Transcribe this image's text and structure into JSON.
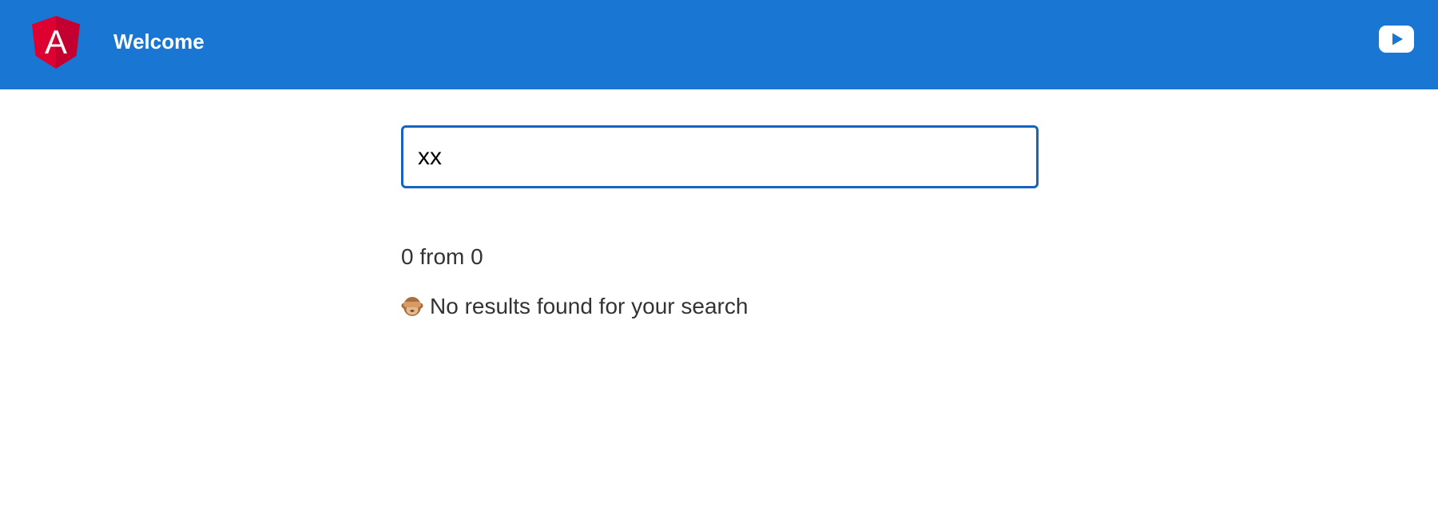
{
  "header": {
    "title": "Welcome",
    "background_color": "#1976d2",
    "logo_icon": "angular-logo-icon",
    "logo_letter": "A",
    "video_link_icon": "youtube-icon"
  },
  "search": {
    "value": "xx",
    "border_color": "#1565c0"
  },
  "results": {
    "count_text": "0 from 0",
    "empty_icon": "see-no-evil-monkey-icon",
    "empty_text": "No results found for your search"
  }
}
